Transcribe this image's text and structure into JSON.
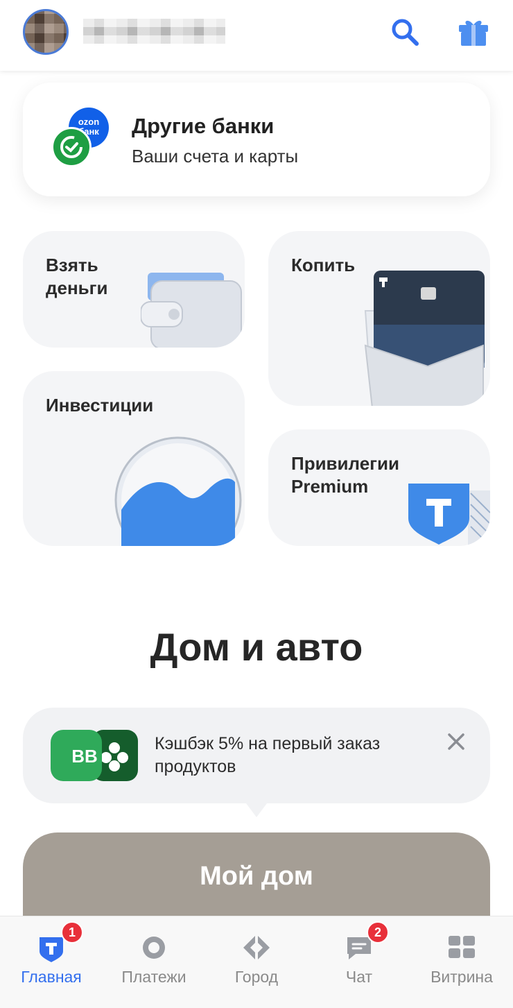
{
  "header": {
    "search_icon": "search-icon",
    "gift_icon": "gift-icon"
  },
  "banks_card": {
    "title": "Другие банки",
    "subtitle": "Ваши счета и карты",
    "ozon_logo_text": "ozon\nбанк"
  },
  "tiles": [
    {
      "label": "Взять\nденьги"
    },
    {
      "label": "Копить"
    },
    {
      "label": "Инвестиции"
    },
    {
      "label": "Привилегии\nPremium"
    }
  ],
  "section": {
    "title": "Дом и авто"
  },
  "promo": {
    "logo_text": "ВВ",
    "text": "Кэшбэк 5% на первый заказ продуктов"
  },
  "my_home": {
    "title": "Мой дом"
  },
  "bottom_nav": {
    "items": [
      {
        "label": "Главная",
        "badge": "1",
        "active": true
      },
      {
        "label": "Платежи"
      },
      {
        "label": "Город"
      },
      {
        "label": "Чат",
        "badge": "2"
      },
      {
        "label": "Витрина"
      }
    ]
  },
  "colors": {
    "accent": "#336fee",
    "badge": "#e8303a",
    "my_home_bg": "#a59e95"
  }
}
